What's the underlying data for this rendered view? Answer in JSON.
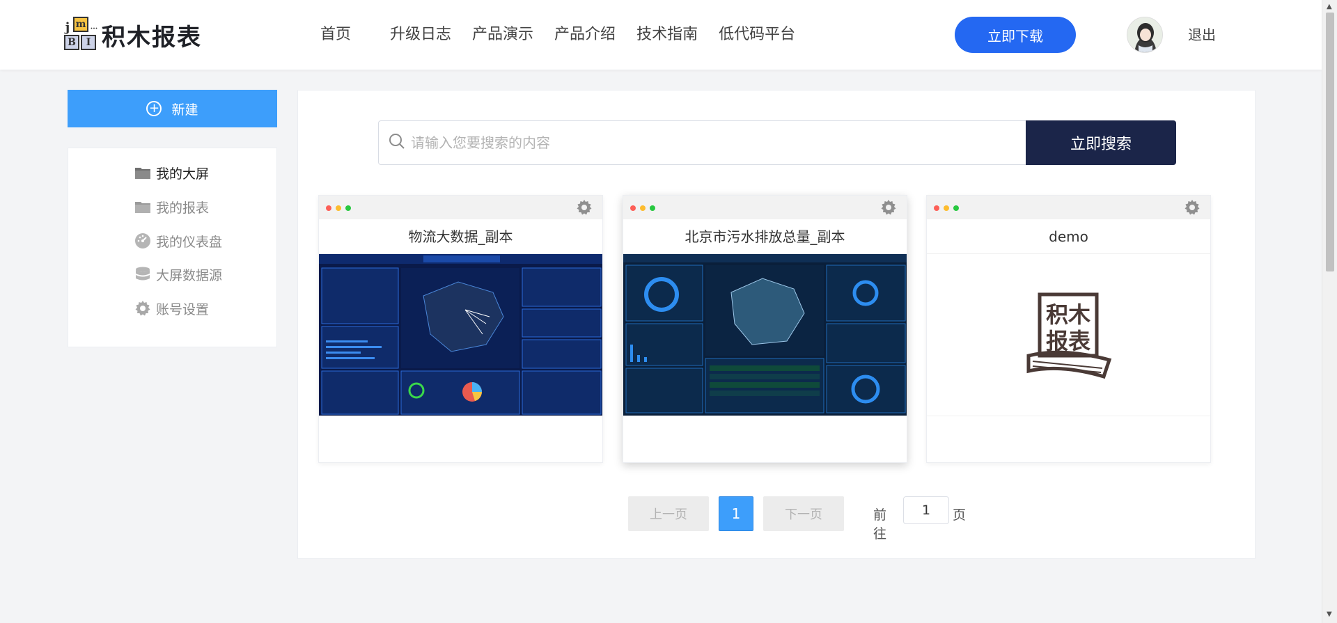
{
  "header": {
    "logo": {
      "blocks": [
        "j",
        "m",
        "B",
        "I"
      ],
      "text": "积木报表"
    },
    "nav": [
      "首页",
      "升级日志",
      "产品演示",
      "产品介绍",
      "技术指南",
      "低代码平台"
    ],
    "download_label": "立即下载",
    "logout_label": "退出"
  },
  "sidebar": {
    "new_label": "新建",
    "items": [
      {
        "label": "我的大屏",
        "icon": "folder-icon",
        "active": true
      },
      {
        "label": "我的报表",
        "icon": "folder-icon",
        "active": false
      },
      {
        "label": "我的仪表盘",
        "icon": "dashboard-icon",
        "active": false
      },
      {
        "label": "大屏数据源",
        "icon": "database-icon",
        "active": false
      },
      {
        "label": "账号设置",
        "icon": "gear-icon",
        "active": false
      }
    ]
  },
  "search": {
    "placeholder": "请输入您要搜索的内容",
    "value": "",
    "button_label": "立即搜索"
  },
  "cards": [
    {
      "title": "物流大数据_副本",
      "thumbnail": "logistics-dashboard-thumbnail"
    },
    {
      "title": "北京市污水排放总量_副本",
      "thumbnail": "sewage-dashboard-thumbnail"
    },
    {
      "title": "demo",
      "thumbnail": "jimu-report-logo"
    }
  ],
  "pagination": {
    "prev_label": "上一页",
    "current_page": "1",
    "next_label": "下一页",
    "goto_label": "前往",
    "goto_value": "1",
    "page_suffix": "页"
  },
  "colors": {
    "primary": "#2468f2",
    "new_button": "#3d9efb",
    "search_button": "#1b2549"
  }
}
